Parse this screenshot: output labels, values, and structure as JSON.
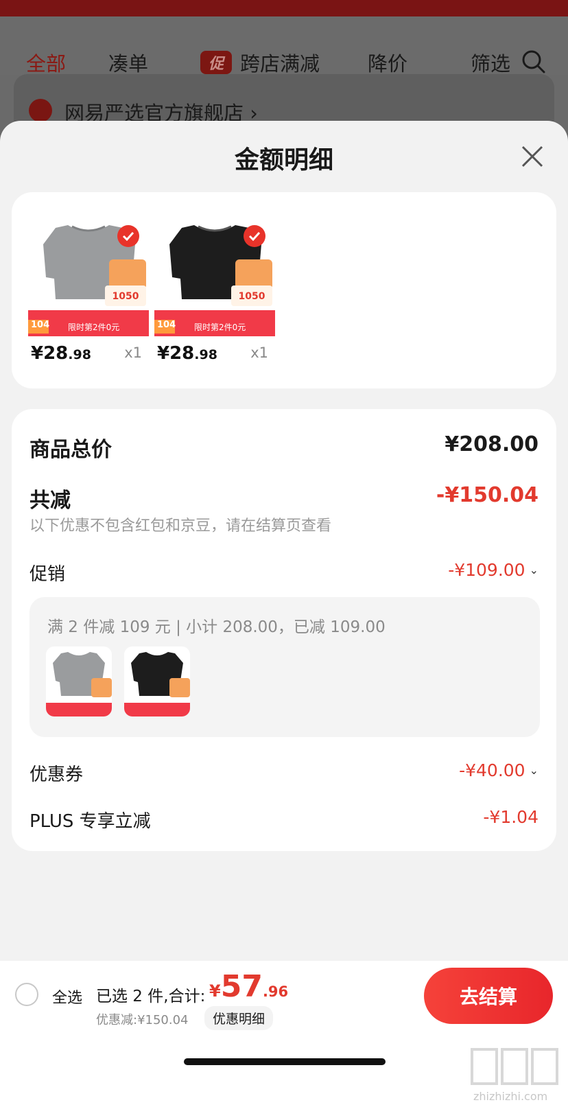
{
  "background": {
    "tabs": [
      "全部",
      "凑单",
      "跨店满减",
      "降价",
      "筛选"
    ],
    "promo_tag": "促",
    "store_name": "网易严选官方旗舰店 ›"
  },
  "sheet": {
    "title": "金额明细",
    "products": [
      {
        "price_int": "¥28",
        "price_dec": ".98",
        "qty": "x1",
        "color": "gray",
        "badge_sale": "限时第2件0元",
        "badge_num": "104"
      },
      {
        "price_int": "¥28",
        "price_dec": ".98",
        "qty": "x1",
        "color": "black",
        "badge_sale": "限时第2件0元",
        "badge_num": "104"
      }
    ],
    "summary": {
      "total_label": "商品总价",
      "total_value": "¥208.00",
      "reduce_label": "共减",
      "reduce_value": "-¥150.04",
      "note": "以下优惠不包含红包和京豆，请在结算页查看",
      "promo_label": "促销",
      "promo_value": "-¥109.00",
      "promo_detail": "满 2 件减 109 元 | 小计 208.00，已减 109.00",
      "coupon_label": "优惠券",
      "coupon_value": "-¥40.00",
      "plus_label": "PLUS 专享立减",
      "plus_value": "-¥1.04"
    }
  },
  "bottom": {
    "select_all": "全选",
    "selected": "已选 2 件,合计:",
    "currency": "¥",
    "total_int": "57",
    "total_dec": ".96",
    "saved": "优惠减:¥150.04",
    "detail": "优惠明细",
    "checkout": "去结算"
  },
  "watermark": "zhizhizhi.com",
  "colors": {
    "accent": "#e23a2e",
    "checkout": "#f5423a"
  }
}
